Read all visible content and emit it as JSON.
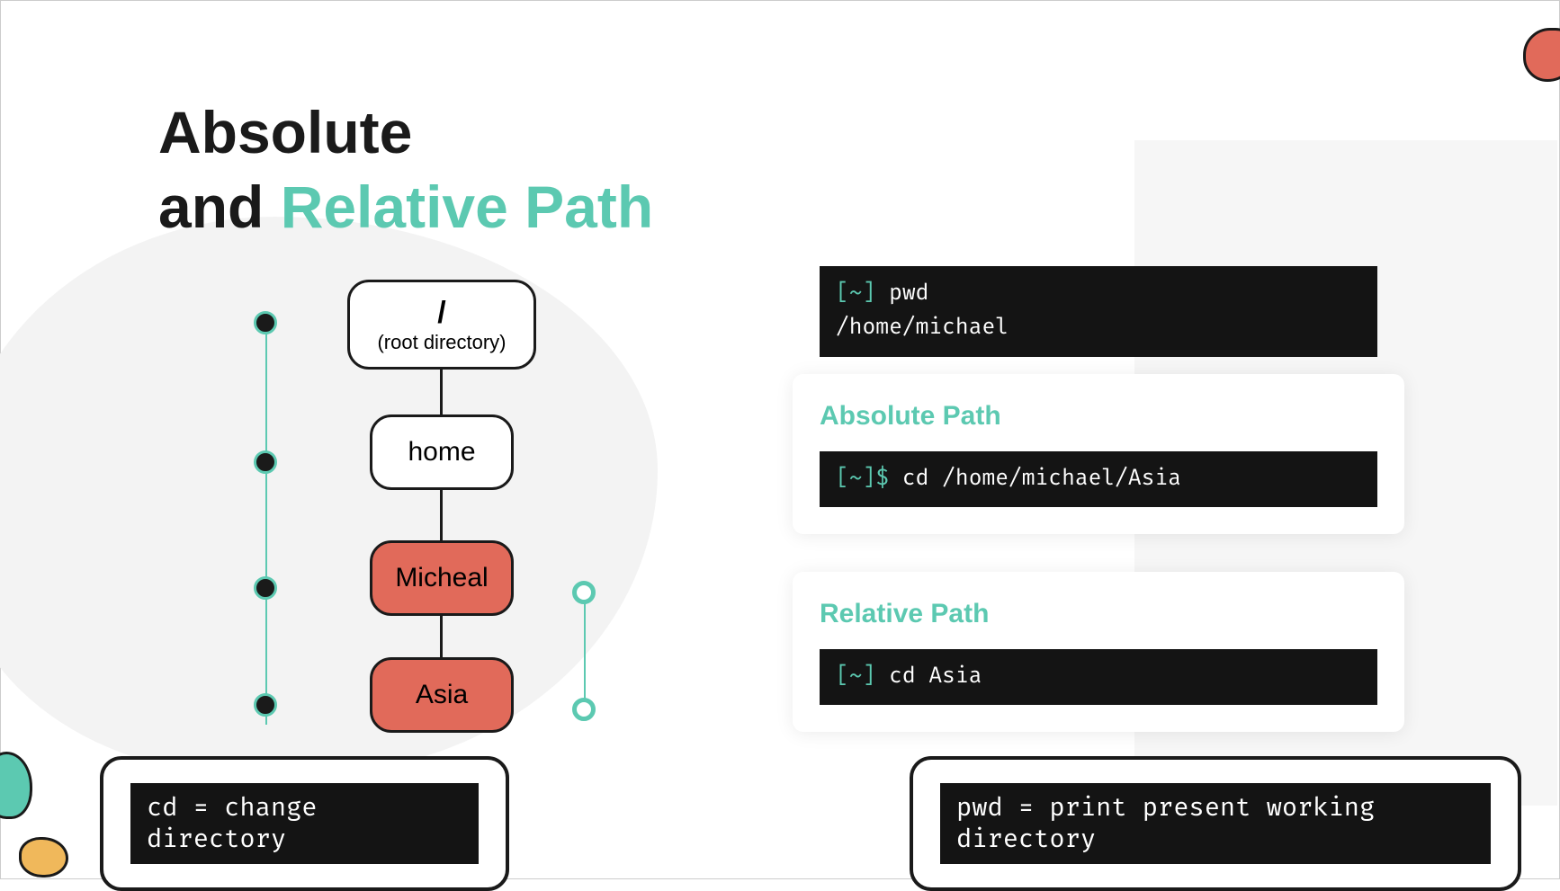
{
  "title": {
    "line1": "Absolute",
    "line2_pre": "and ",
    "line2_accent": "Relative Path"
  },
  "tree": {
    "root_slash": "/",
    "root_sub": "(root directory)",
    "home": "home",
    "micheal": "Micheal",
    "asia": "Asia"
  },
  "terminal_pwd": {
    "prompt": "[~]",
    "cmd": " pwd",
    "output": "/home/michael"
  },
  "absolute": {
    "title": "Absolute Path",
    "prompt": "[~]$",
    "cmd": " cd /home/michael/Asia"
  },
  "relative": {
    "title": "Relative Path",
    "prompt": "[~]",
    "cmd": " cd Asia"
  },
  "def_cd": "cd =  change directory",
  "def_pwd": "pwd =  print present working directory"
}
